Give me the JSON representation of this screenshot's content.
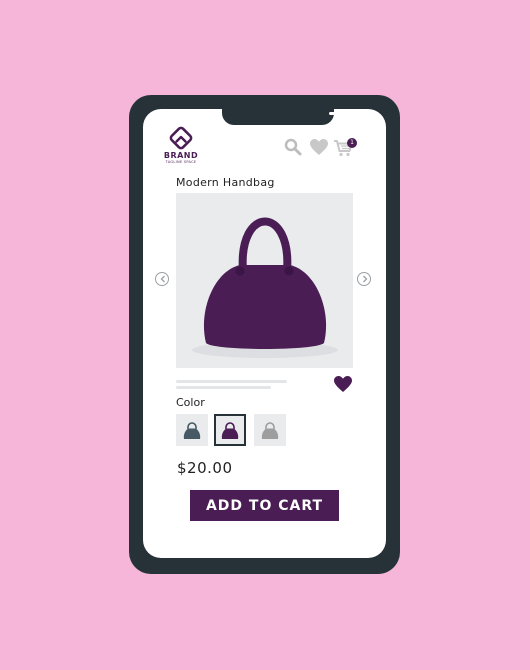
{
  "brand": {
    "name": "BRAND",
    "tagline": "TAGLINE SPACE",
    "icon": "diamond-logo-icon"
  },
  "header": {
    "icons": [
      "search-icon",
      "heart-icon",
      "cart-icon"
    ],
    "cart_count": "1"
  },
  "product": {
    "title": "Modern Handbag",
    "price": "$20.00",
    "wishlist_icon": "heart-icon",
    "image_icon": "handbag-icon"
  },
  "color": {
    "label": "Color",
    "options": [
      "#455a64",
      "#4a1d55",
      "#9e9e9e"
    ],
    "selected_index": 1
  },
  "carousel": {
    "prev_icon": "chevron-left-icon",
    "next_icon": "chevron-right-icon"
  },
  "actions": {
    "add_to_cart_label": "ADD TO CART"
  },
  "colors": {
    "background": "#f5b6d9",
    "phone_frame": "#263238",
    "accent": "#4a1d55"
  }
}
